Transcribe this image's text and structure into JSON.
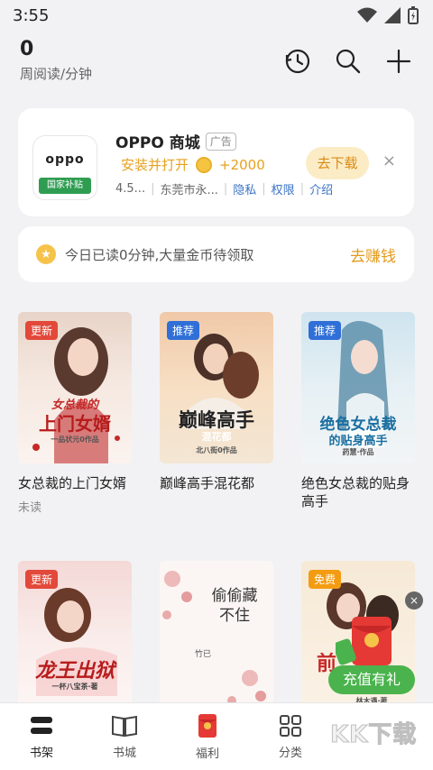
{
  "status": {
    "time": "3:55"
  },
  "header": {
    "count": "0",
    "unit": "周阅读/分钟"
  },
  "ad": {
    "logo_word": "oppo",
    "logo_band": "国家补贴",
    "title": "OPPO 商城",
    "tag": "广告",
    "subtitle": "安装并打开",
    "reward": "+2000",
    "rating": "4.5...",
    "company": "东莞市永...",
    "links": [
      "隐私",
      "权限",
      "介绍"
    ],
    "download": "去下载",
    "close": "×"
  },
  "reward_bar": {
    "text": "今日已读0分钟,大量金币待领取",
    "cta": "去赚钱"
  },
  "books": [
    {
      "title": "女总裁的上门女婿",
      "badge": "更新",
      "status": "未读",
      "cover_title": "上门女婿",
      "cover_sub": "女总裁的",
      "cover_author": "一品状元0作品"
    },
    {
      "title": "巅峰高手混花都",
      "badge": "推荐",
      "status": "",
      "cover_title": "巅峰高手",
      "cover_sub": "混花都",
      "cover_author": "北八街0作品"
    },
    {
      "title": "绝色女总裁的贴身高手",
      "badge": "推荐",
      "status": "",
      "cover_title": "绝色女总裁",
      "cover_sub": "的贴身高手",
      "cover_author": "药慧·作品"
    },
    {
      "title": "",
      "badge": "更新",
      "status": "",
      "cover_title": "龙王出狱",
      "cover_sub": "",
      "cover_author": "一杯八宝茶·著"
    },
    {
      "title": "",
      "badge": "",
      "status": "",
      "cover_title": "偷偷藏不住",
      "cover_sub": "",
      "cover_author": "竹已"
    },
    {
      "title": "",
      "badge": "免费",
      "status": "",
      "cover_title": "前",
      "cover_sub": "",
      "cover_author": "林木遇·著"
    }
  ],
  "promo": {
    "label": "充值有礼",
    "close": "×"
  },
  "nav": [
    {
      "label": "书架",
      "active": true
    },
    {
      "label": "书城",
      "active": false
    },
    {
      "label": "福利",
      "active": false
    },
    {
      "label": "分类",
      "active": false
    }
  ],
  "watermark": "KK下载",
  "colors": {
    "accent_orange": "#e39b1c",
    "badge_red": "#e2493a",
    "badge_blue": "#2f6fd7",
    "promo_green": "#4ab34d"
  }
}
